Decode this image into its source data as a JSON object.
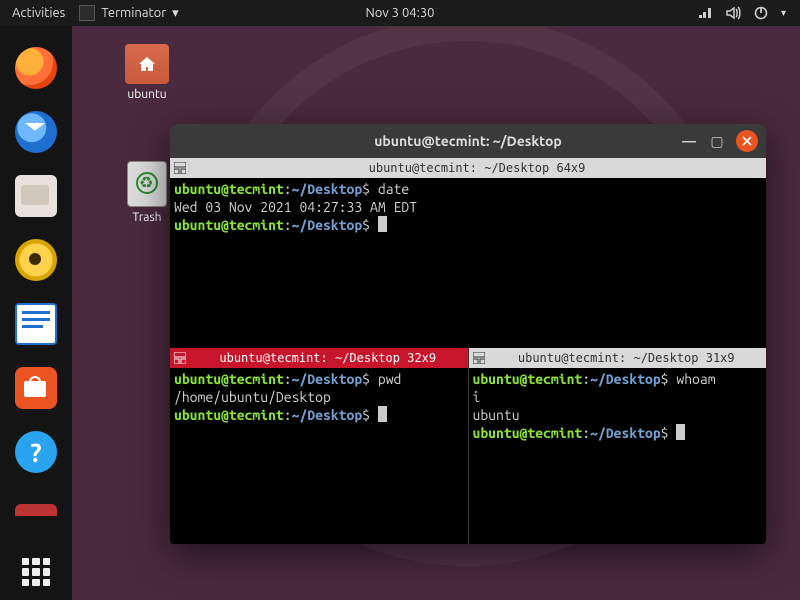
{
  "topbar": {
    "activities": "Activities",
    "app_name": "Terminator",
    "dropdown_arrow": "▾",
    "clock": "Nov 3  04:30"
  },
  "desktop": {
    "icons": {
      "home": {
        "label": "ubuntu"
      },
      "trash": {
        "label": "Trash"
      }
    }
  },
  "window": {
    "title": "ubuntu@tecmint: ~/Desktop",
    "panes": {
      "top": {
        "header": "ubuntu@tecmint: ~/Desktop 64x9",
        "prompt_user": "ubuntu@tecmint",
        "prompt_sep": ":",
        "prompt_path": "~/Desktop",
        "prompt_sign": "$",
        "cmd1": "date",
        "out1": "Wed 03 Nov 2021 04:27:33 AM EDT"
      },
      "bl": {
        "header": "ubuntu@tecmint: ~/Desktop 32x9",
        "cmd1": "pwd",
        "out1": "/home/ubuntu/Desktop"
      },
      "br": {
        "header": "ubuntu@tecmint: ~/Desktop 31x9",
        "cmd1_a": "whoam",
        "cmd1_b": "i",
        "out1": "ubuntu"
      }
    }
  }
}
